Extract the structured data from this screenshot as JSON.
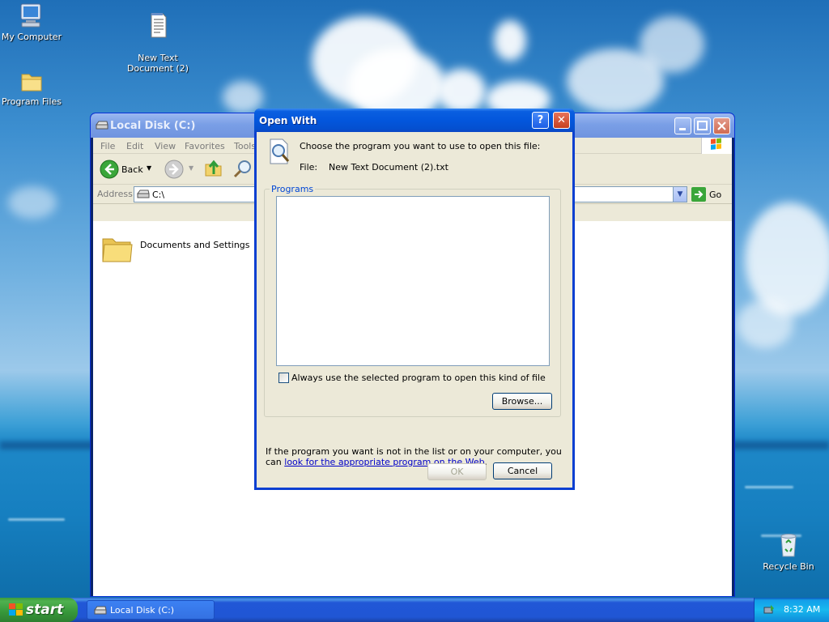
{
  "desktop": {
    "icons": [
      {
        "label": "My Computer"
      },
      {
        "label": "New Text\nDocument (2)"
      },
      {
        "label": "Program Files"
      },
      {
        "label": "Recycle Bin"
      }
    ]
  },
  "explorer": {
    "title": "Local Disk (C:)",
    "menu": [
      "File",
      "Edit",
      "View",
      "Favorites",
      "Tools"
    ],
    "toolbar": {
      "back_label": "Back"
    },
    "address": {
      "label": "Address",
      "value": "C:\\",
      "go_label": "Go"
    },
    "items": [
      {
        "label": "Documents and Settings"
      }
    ]
  },
  "dialog": {
    "title": "Open With",
    "help_label": "?",
    "close_label": "✕",
    "prompt": "Choose the program you want to use to open this file:",
    "file_label": "File:",
    "file_name": "New Text Document (2).txt",
    "programs_label": "Programs",
    "always_use_label": "Always use the selected program to open this kind of file",
    "always_use_checked": false,
    "browse_label": "Browse...",
    "info_text": "If the program you want is not in the list or on your computer, you can ",
    "info_link": "look for the appropriate program on the Web",
    "info_end": ".",
    "ok_label": "OK",
    "cancel_label": "Cancel"
  },
  "taskbar": {
    "start_label": "start",
    "task_label": "Local Disk (C:)",
    "clock": "8:32 AM"
  },
  "colors": {
    "dialog_title": "#0356dc",
    "link": "#0000c8",
    "start_green": "#36973a"
  }
}
